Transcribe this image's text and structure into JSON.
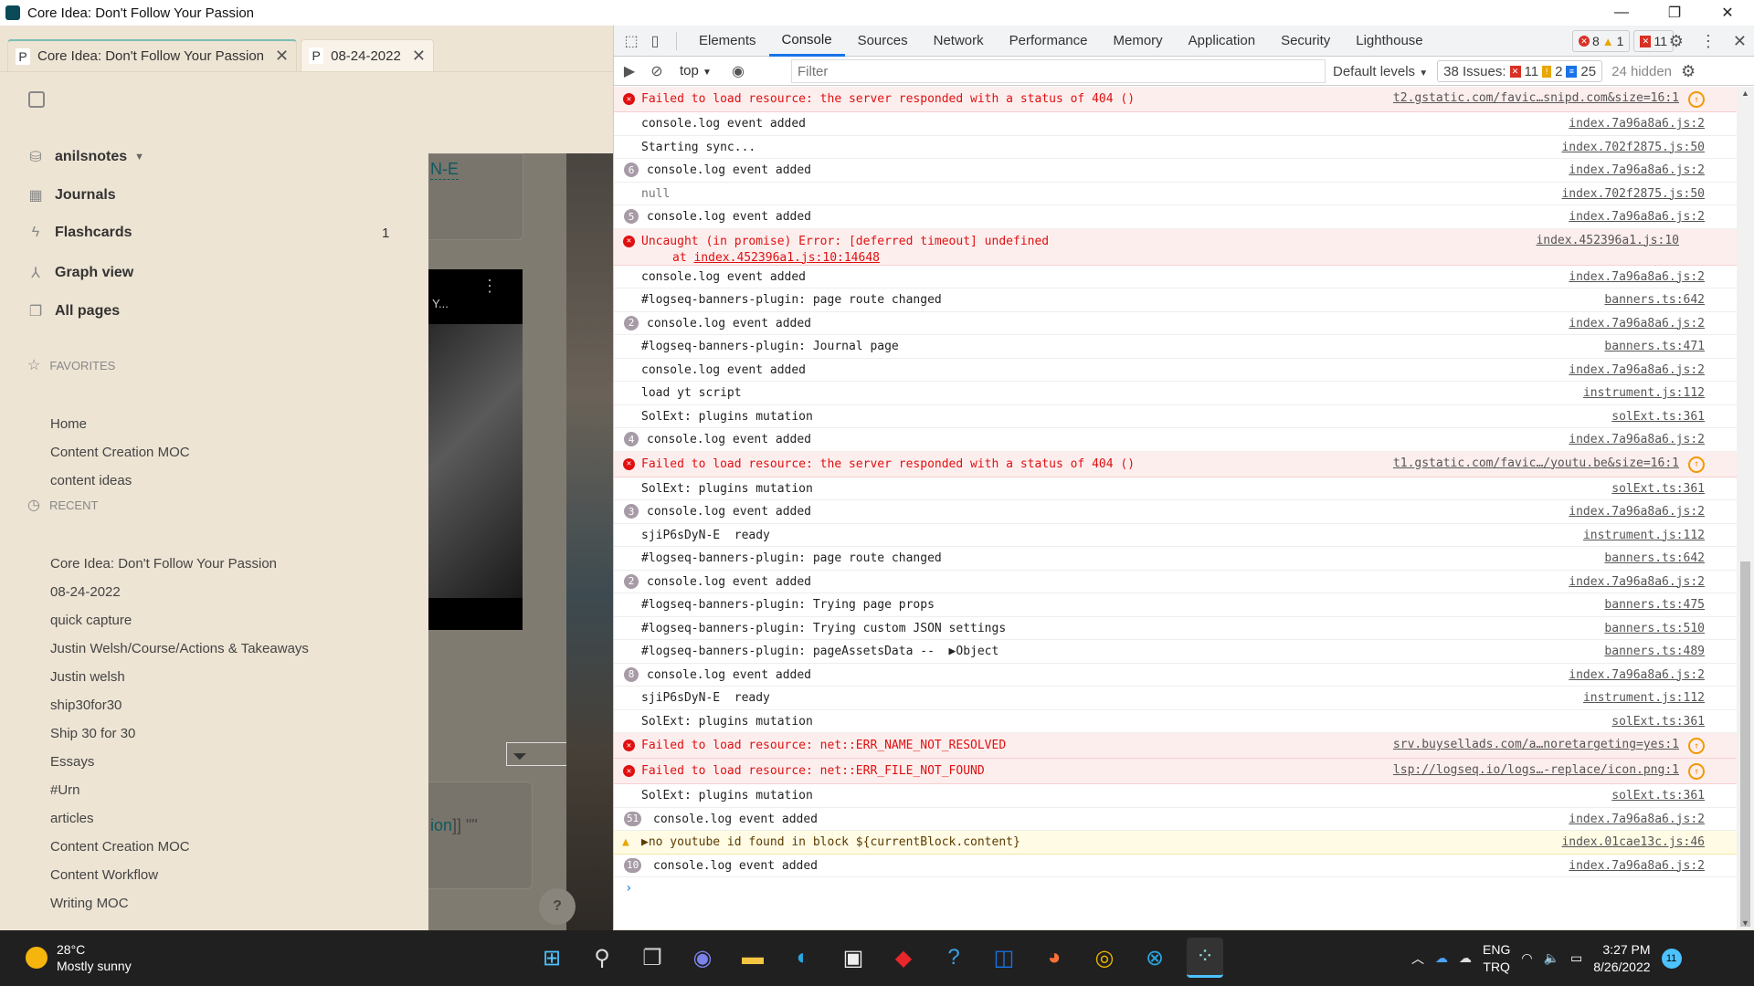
{
  "window": {
    "title": "Core Idea: Don't Follow Your Passion",
    "minimize": "—",
    "restore": "❐",
    "close": "✕"
  },
  "tabs": [
    {
      "icon": "P",
      "label": "Core Idea: Don't Follow Your Passion",
      "close": "✕"
    },
    {
      "icon": "P",
      "label": "08-24-2022",
      "close": "✕"
    }
  ],
  "sidebar": {
    "graph": "anilsnotes",
    "nav": [
      {
        "label": "Journals",
        "icon": "calendar-icon"
      },
      {
        "label": "Flashcards",
        "icon": "bolt-icon",
        "count": "1"
      },
      {
        "label": "Graph view",
        "icon": "graph-icon"
      },
      {
        "label": "All pages",
        "icon": "pages-icon"
      }
    ],
    "favorites_title": "FAVORITES",
    "favorites": [
      "Home",
      "Content Creation MOC",
      "content ideas"
    ],
    "recent_title": "RECENT",
    "recent": [
      "Core Idea: Don't Follow Your Passion",
      "08-24-2022",
      "quick capture",
      "Justin Welsh/Course/Actions & Takeaways",
      "Justin welsh",
      "ship30for30",
      "Ship 30 for 30",
      "Essays",
      "#Urn",
      "articles",
      "Content Creation MOC",
      "Content Workflow",
      "Writing MOC"
    ]
  },
  "page": {
    "link_fragment": "N-E",
    "video_title_fragment": "Y...",
    "ref_fragment": "ion",
    "ref_suffix": "]] \"\"",
    "help": "?"
  },
  "devtools": {
    "tabs": [
      "Elements",
      "Console",
      "Sources",
      "Network",
      "Performance",
      "Memory",
      "Application",
      "Security",
      "Lighthouse"
    ],
    "active_tab": "Console",
    "error_count": "8",
    "warning_count": "1",
    "issue_badge_count": "11",
    "context": "top",
    "filter_placeholder": "Filter",
    "levels": "Default levels",
    "issues_label": "38 Issues:",
    "issues_errors": "11",
    "issues_warnings": "2",
    "issues_info": "25",
    "hidden": "24 hidden",
    "prompt": "›"
  },
  "console": [
    {
      "type": "error",
      "msg": "Failed to load resource: the server responded with a status of 404 ()",
      "src": "t2.gstatic.com/favic…snipd.com&size=16:1",
      "net": true
    },
    {
      "type": "log",
      "msg": "console.log event added",
      "src": "index.7a96a8a6.js:2"
    },
    {
      "type": "log",
      "msg": "Starting sync...",
      "src": "index.702f2875.js:50"
    },
    {
      "type": "log",
      "count": "6",
      "msg": "console.log event added",
      "src": "index.7a96a8a6.js:2"
    },
    {
      "type": "dim",
      "msg": "null",
      "src": "index.702f2875.js:50"
    },
    {
      "type": "log",
      "count": "5",
      "msg": "console.log event added",
      "src": "index.7a96a8a6.js:2"
    },
    {
      "type": "error",
      "msg": "Uncaught (in promise) Error: [deferred timeout] undefined",
      "msg2_prefix": "at ",
      "msg2_link": "index.452396a1.js:10:14648",
      "src": "index.452396a1.js:10"
    },
    {
      "type": "log",
      "msg": "console.log event added",
      "src": "index.7a96a8a6.js:2"
    },
    {
      "type": "log",
      "msg": "#logseq-banners-plugin: page route changed",
      "src": "banners.ts:642"
    },
    {
      "type": "log",
      "count": "2",
      "msg": "console.log event added",
      "src": "index.7a96a8a6.js:2"
    },
    {
      "type": "log",
      "msg": "#logseq-banners-plugin: Journal page",
      "src": "banners.ts:471"
    },
    {
      "type": "log",
      "msg": "console.log event added",
      "src": "index.7a96a8a6.js:2"
    },
    {
      "type": "log",
      "msg": "load yt script",
      "src": "instrument.js:112"
    },
    {
      "type": "log",
      "msg": "SolExt: plugins mutation",
      "src": "solExt.ts:361"
    },
    {
      "type": "log",
      "count": "4",
      "msg": "console.log event added",
      "src": "index.7a96a8a6.js:2"
    },
    {
      "type": "error",
      "msg": "Failed to load resource: the server responded with a status of 404 ()",
      "src": "t1.gstatic.com/favic…/youtu.be&size=16:1",
      "net": true
    },
    {
      "type": "log",
      "msg": "SolExt: plugins mutation",
      "src": "solExt.ts:361"
    },
    {
      "type": "log",
      "count": "3",
      "msg": "console.log event added",
      "src": "index.7a96a8a6.js:2"
    },
    {
      "type": "log",
      "msg": "sjiP6sDyN-E  ready",
      "src": "instrument.js:112"
    },
    {
      "type": "log",
      "msg": "#logseq-banners-plugin: page route changed",
      "src": "banners.ts:642"
    },
    {
      "type": "log",
      "count": "2",
      "msg": "console.log event added",
      "src": "index.7a96a8a6.js:2"
    },
    {
      "type": "log",
      "msg": "#logseq-banners-plugin: Trying page props",
      "src": "banners.ts:475"
    },
    {
      "type": "log",
      "msg": "#logseq-banners-plugin: Trying custom JSON settings",
      "src": "banners.ts:510"
    },
    {
      "type": "log",
      "msg": "#logseq-banners-plugin: pageAssetsData --  ▶Object",
      "src": "banners.ts:489"
    },
    {
      "type": "log",
      "count": "8",
      "msg": "console.log event added",
      "src": "index.7a96a8a6.js:2"
    },
    {
      "type": "log",
      "msg": "sjiP6sDyN-E  ready",
      "src": "instrument.js:112"
    },
    {
      "type": "log",
      "msg": "SolExt: plugins mutation",
      "src": "solExt.ts:361"
    },
    {
      "type": "error",
      "msg": "Failed to load resource: net::ERR_NAME_NOT_RESOLVED",
      "src": "srv.buysellads.com/a…noretargeting=yes:1",
      "net": true
    },
    {
      "type": "error",
      "msg": "Failed to load resource: net::ERR_FILE_NOT_FOUND",
      "src": "lsp://logseq.io/logs…-replace/icon.png:1",
      "net": true
    },
    {
      "type": "log",
      "msg": "SolExt: plugins mutation",
      "src": "solExt.ts:361"
    },
    {
      "type": "log",
      "count": "51",
      "msg": "console.log event added",
      "src": "index.7a96a8a6.js:2"
    },
    {
      "type": "warning",
      "msg": "▶no youtube id found in block ${currentBlock.content}",
      "src": "index.01cae13c.js:46"
    },
    {
      "type": "log",
      "count": "10",
      "msg": "console.log event added",
      "src": "index.7a96a8a6.js:2"
    }
  ],
  "taskbar": {
    "temp": "28°C",
    "weather": "Mostly sunny",
    "lang": "ENG",
    "layout": "TRQ",
    "time": "3:27 PM",
    "date": "8/26/2022",
    "notifications": "11",
    "apps": [
      "start",
      "search",
      "task-view",
      "teams",
      "file-explorer",
      "edge",
      "store",
      "app-red",
      "app-help",
      "outlook",
      "firefox",
      "chrome",
      "app-blue",
      "logseq"
    ]
  }
}
